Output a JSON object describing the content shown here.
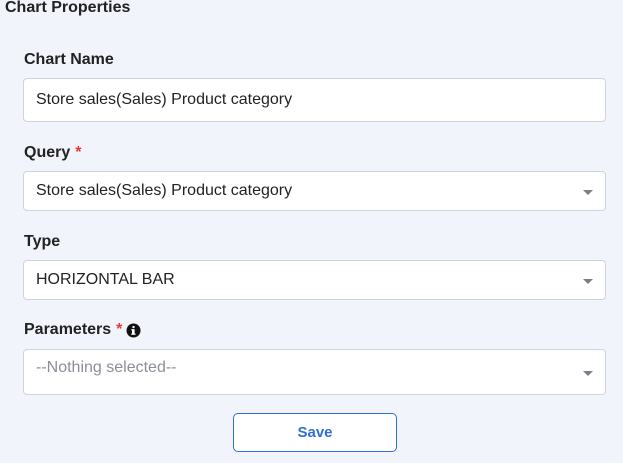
{
  "panel": {
    "title": "Chart Properties"
  },
  "chart_name": {
    "label": "Chart Name",
    "value": "Store sales(Sales) Product category"
  },
  "query": {
    "label": "Query",
    "required_mark": "*",
    "selected": "Store sales(Sales) Product category"
  },
  "type": {
    "label": "Type",
    "selected": "HORIZONTAL BAR"
  },
  "parameters": {
    "label": "Parameters",
    "required_mark": "*",
    "icon": "info-icon",
    "placeholder": "--Nothing selected--"
  },
  "actions": {
    "save_label": "Save"
  },
  "colors": {
    "background": "#f2f4fb",
    "required": "#e53935",
    "accent": "#2f6fd8"
  }
}
